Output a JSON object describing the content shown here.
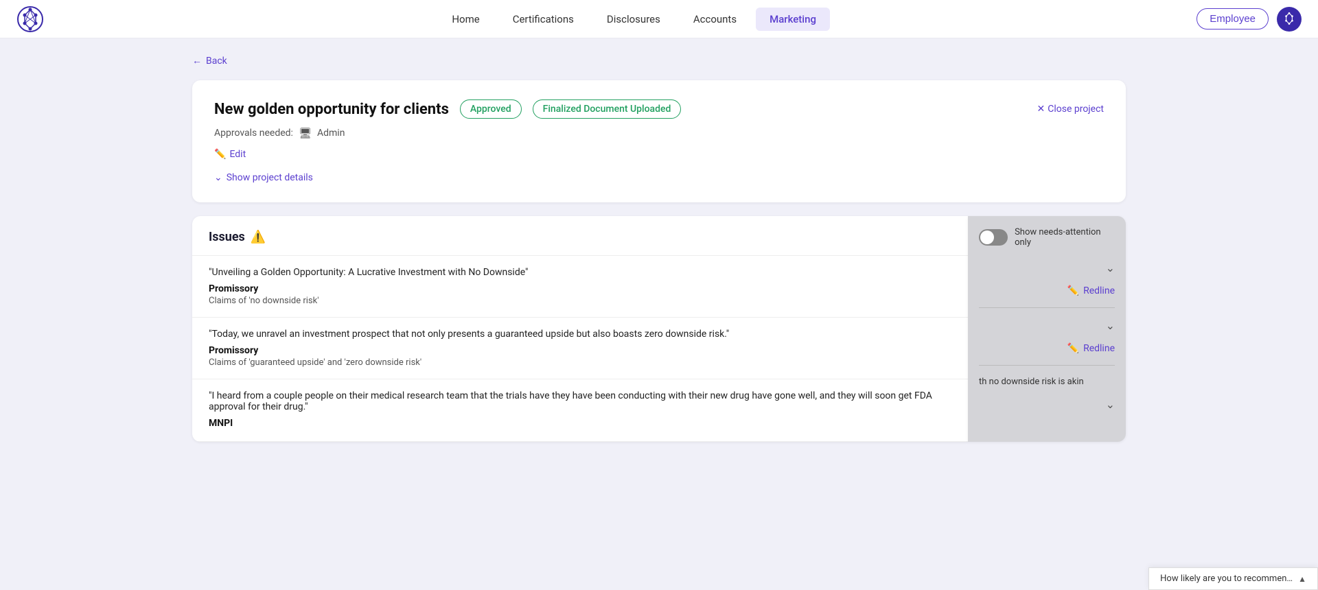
{
  "header": {
    "nav_items": [
      {
        "label": "Home",
        "active": false
      },
      {
        "label": "Certifications",
        "active": false
      },
      {
        "label": "Disclosures",
        "active": false
      },
      {
        "label": "Accounts",
        "active": false
      },
      {
        "label": "Marketing",
        "active": true
      }
    ],
    "employee_btn": "Employee"
  },
  "back": {
    "label": "Back"
  },
  "project": {
    "title": "New golden opportunity for clients",
    "badges": {
      "approved": "Approved",
      "finalized": "Finalized Document Uploaded"
    },
    "close_label": "Close project",
    "approvals_label": "Approvals needed:",
    "approvals_value": "Admin",
    "edit_label": "Edit",
    "show_details_label": "Show project details"
  },
  "issues": {
    "title": "Issues",
    "rows": [
      {
        "quote": "\"Unveiling a Golden Opportunity: A Lucrative Investment with No Downside\"",
        "type": "Promissory",
        "desc": "Claims of 'no downside risk'"
      },
      {
        "quote": "\"Today, we unravel an investment prospect that not only presents a guaranteed upside but also boasts zero downside risk.\"",
        "type": "Promissory",
        "desc": "Claims of 'guaranteed upside' and 'zero downside risk'"
      },
      {
        "quote": "\"I heard from a couple people on their medical research team that the trials have they have been conducting with their new drug have gone well, and they will soon get FDA approval for their drug.\"",
        "type": "MNPI",
        "desc": ""
      }
    ]
  },
  "side_panel": {
    "toggle_label": "Show needs-attention only",
    "redline_label": "Redline",
    "bottom_text": "th no downside risk is akin"
  },
  "feedback_bar": {
    "text": "How likely are you to recommen…"
  }
}
